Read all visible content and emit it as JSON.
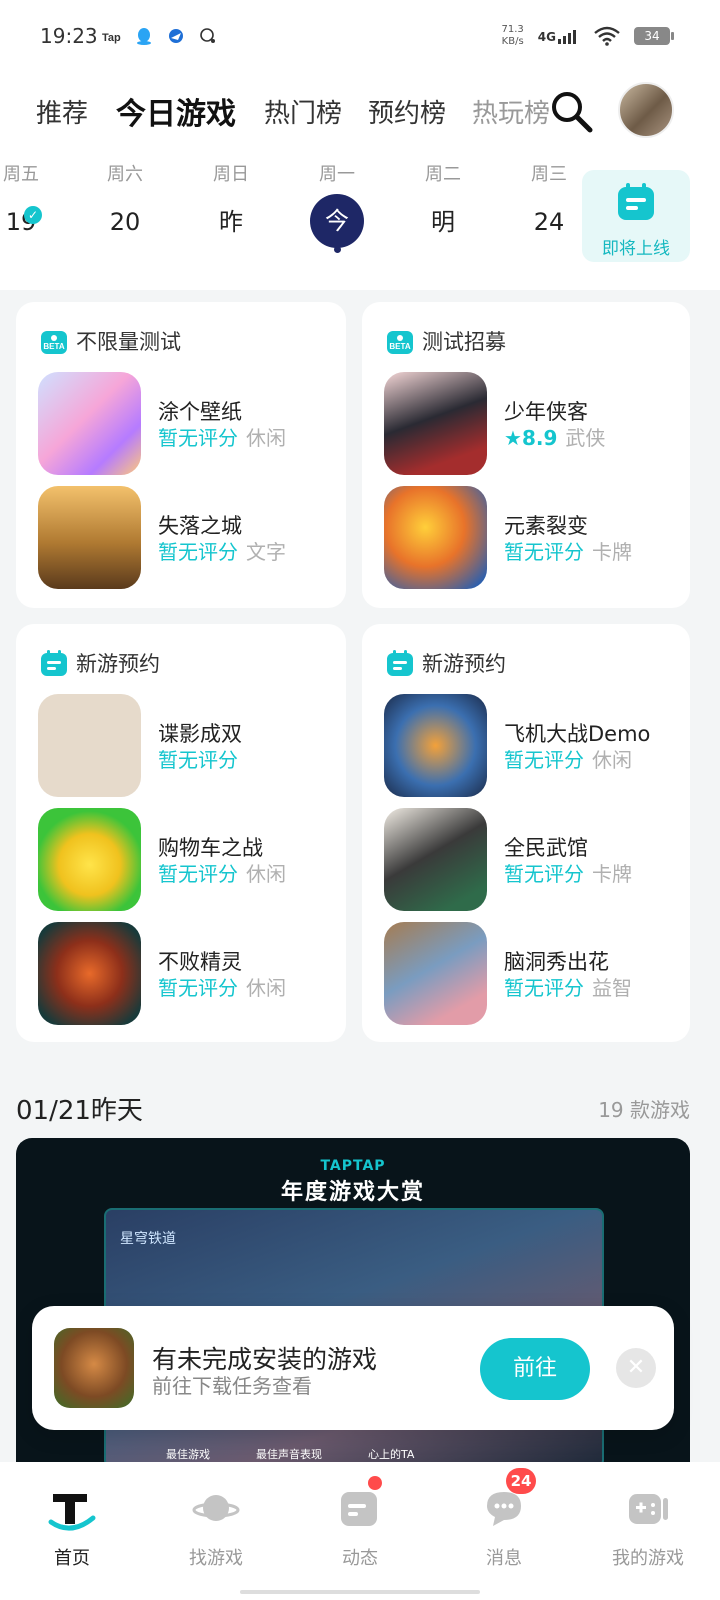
{
  "status_bar": {
    "time": "19:23",
    "net_speed_value": "71.3",
    "net_speed_unit": "KB/s",
    "network": "4G",
    "battery": "34",
    "app_icons": [
      "taptap-icon",
      "qq-icon",
      "bird-icon",
      "chat-icon"
    ]
  },
  "tabs": [
    {
      "label": "推荐"
    },
    {
      "label": "今日游戏"
    },
    {
      "label": "热门榜"
    },
    {
      "label": "预约榜"
    },
    {
      "label": "热玩榜"
    }
  ],
  "calendar": {
    "days": [
      {
        "weekday": "周五",
        "num": "19",
        "checked": true
      },
      {
        "weekday": "周六",
        "num": "20"
      },
      {
        "weekday": "周日",
        "num": "昨"
      },
      {
        "weekday": "周一",
        "num": "今",
        "today": true
      },
      {
        "weekday": "周二",
        "num": "明"
      },
      {
        "weekday": "周三",
        "num": "24"
      }
    ],
    "upcoming_label": "即将上线"
  },
  "cards": [
    {
      "title": "不限量测试",
      "games": [
        {
          "name": "涂个壁纸",
          "rating": "暂无评分",
          "genre": "休闲"
        },
        {
          "name": "失落之城",
          "rating": "暂无评分",
          "genre": "文字"
        }
      ]
    },
    {
      "title": "测试招募",
      "games": [
        {
          "name": "少年侠客",
          "rating": "8.9",
          "genre": "武侠"
        },
        {
          "name": "元素裂变",
          "rating": "暂无评分",
          "genre": "卡牌"
        }
      ]
    },
    {
      "title": "新游预约",
      "games": [
        {
          "name": "谍影成双",
          "rating": "暂无评分",
          "genre": ""
        },
        {
          "name": "购物车之战",
          "rating": "暂无评分",
          "genre": "休闲"
        },
        {
          "name": "不败精灵",
          "rating": "暂无评分",
          "genre": "休闲"
        }
      ]
    },
    {
      "title": "新游预约",
      "games": [
        {
          "name": "飞机大战Demo",
          "rating": "暂无评分",
          "genre": "休闲"
        },
        {
          "name": "全民武馆",
          "rating": "暂无评分",
          "genre": "卡牌"
        },
        {
          "name": "脑洞秀出花",
          "rating": "暂无评分",
          "genre": "益智"
        }
      ]
    }
  ],
  "section": {
    "date": "01/21昨天",
    "count": "19 款游戏"
  },
  "banner": {
    "logo_brand": "TAPTAP",
    "logo_title": "年度游戏大赏",
    "game_tag": "星穹铁道",
    "awards": [
      "最佳游戏",
      "最佳声音表现",
      "心上的TA"
    ]
  },
  "toast": {
    "title": "有未完成安装的游戏",
    "subtitle": "前往下载任务查看",
    "button": "前往"
  },
  "bottom_nav": [
    {
      "label": "首页",
      "icon": "home-icon"
    },
    {
      "label": "找游戏",
      "icon": "planet-icon"
    },
    {
      "label": "动态",
      "icon": "feed-icon"
    },
    {
      "label": "消息",
      "icon": "message-icon",
      "badge": "24"
    },
    {
      "label": "我的游戏",
      "icon": "gamepad-icon"
    }
  ],
  "colors": {
    "accent": "#15c5ce",
    "today": "#1e2766",
    "badge": "#ff4b4b"
  }
}
